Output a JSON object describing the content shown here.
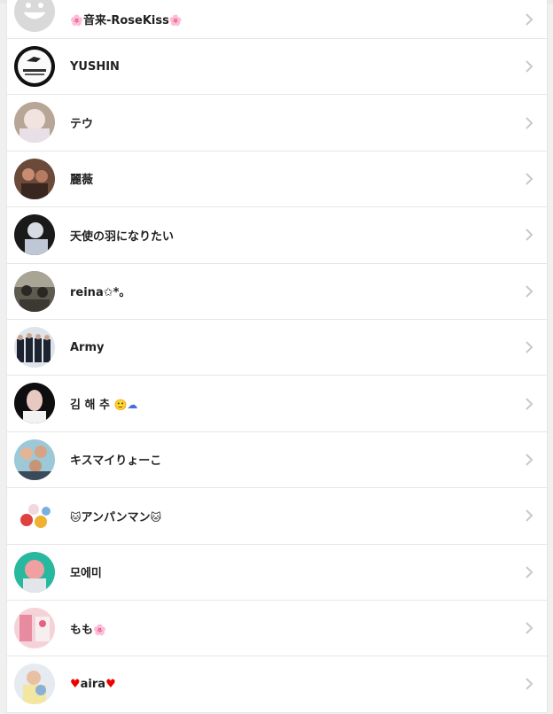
{
  "contacts": [
    {
      "name": "音来-RoseKiss",
      "pre": "🌸",
      "post": "🌸"
    },
    {
      "name": "YUSHIN",
      "pre": "",
      "post": ""
    },
    {
      "name": "テウ",
      "pre": "",
      "post": ""
    },
    {
      "name": "麗薇",
      "pre": "",
      "post": ""
    },
    {
      "name": "天使の羽になりたい",
      "pre": "",
      "post": ""
    },
    {
      "name": "reina✩*。",
      "pre": "",
      "post": ""
    },
    {
      "name": "Army",
      "pre": "",
      "post": ""
    },
    {
      "name": "김 해 추",
      "pre": "",
      "post": "🙂☁"
    },
    {
      "name": "キスマイりょーこ",
      "pre": "",
      "post": ""
    },
    {
      "name": "アンパンマン",
      "pre": "🐱",
      "post": "🐱"
    },
    {
      "name": "모에미",
      "pre": "",
      "post": ""
    },
    {
      "name": "もも",
      "pre": "",
      "post": "🌸"
    },
    {
      "name": "aira",
      "pre": "♥",
      "post": "♥"
    }
  ],
  "icons": {
    "chevron": "chevron-right-icon",
    "avatar": "avatar-photo"
  },
  "colors": {
    "row_bg": "#ffffff",
    "page_bg": "#f0f0f0",
    "divider": "#e6e6e6",
    "chevron": "#c9c9c9"
  }
}
